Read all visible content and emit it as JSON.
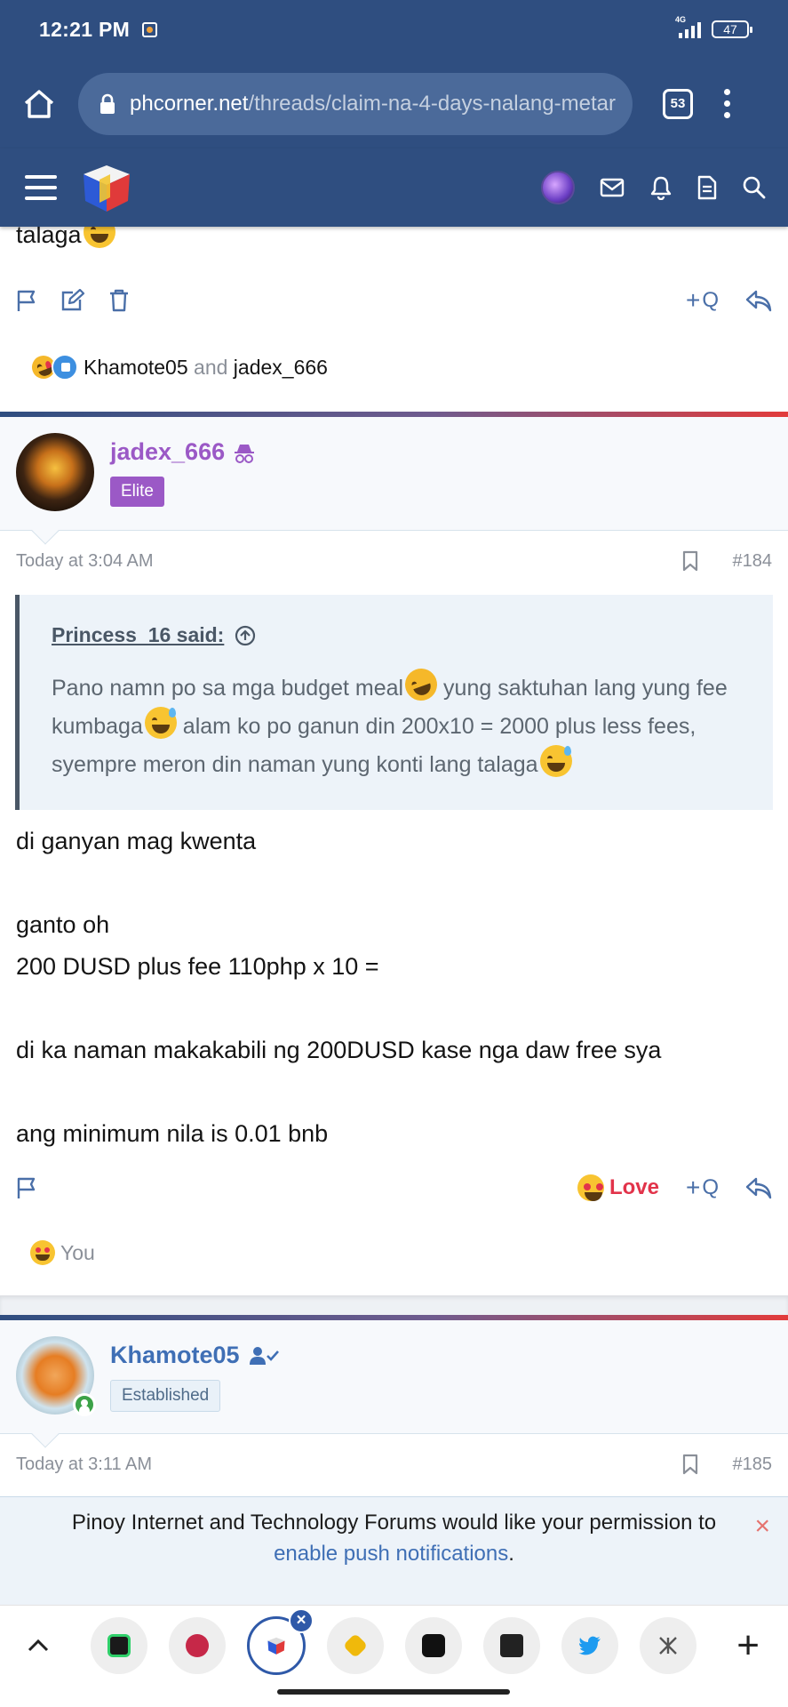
{
  "status_bar": {
    "time": "12:21 PM",
    "network": "4G",
    "battery": "47"
  },
  "browser": {
    "url_host": "phcorner.net",
    "url_path": "/threads/claim-na-4-days-nalang-metar",
    "tab_count": "53"
  },
  "prev_post": {
    "last_line": "talaga",
    "reactions": {
      "user1": "Khamote05",
      "and": "and",
      "user2": "jadex_666"
    },
    "quote_label": "Q"
  },
  "post1": {
    "username": "jadex_666",
    "badge": "Elite",
    "time": "Today at 3:04 AM",
    "number": "#184",
    "quote": {
      "attribution": "Princess_16 said:",
      "text_1": "Pano namn po sa mga budget meal",
      "text_2": " yung saktuhan lang yung fee kumbaga",
      "text_3": " alam ko po ganun din 200x10 = 2000 plus less fees, syempre meron din naman yung konti lang talaga"
    },
    "body": [
      "di ganyan mag kwenta",
      "ganto oh",
      "200 DUSD plus fee 110php x 10 =",
      "di ka naman makakabili ng 200DUSD kase nga daw free sya",
      "ang minimum nila is 0.01 bnb"
    ],
    "love_label": "Love",
    "quote_label": "Q",
    "reaction_user": "You"
  },
  "post2": {
    "username": "Khamote05",
    "badge": "Established",
    "time": "Today at 3:11 AM",
    "number": "#185"
  },
  "push_banner": {
    "text": "Pinoy Internet and Technology Forums would like your permission to",
    "link": "enable push notifications",
    "end": ".",
    "close": "×"
  },
  "bottom_bar": {
    "close_badge": "×",
    "plus": "+"
  },
  "colors": {
    "header_bg": "#2f4e80",
    "accent_blue": "#3f6fb5",
    "elite_purple": "#9b59c6",
    "love_red": "#e2334a"
  }
}
